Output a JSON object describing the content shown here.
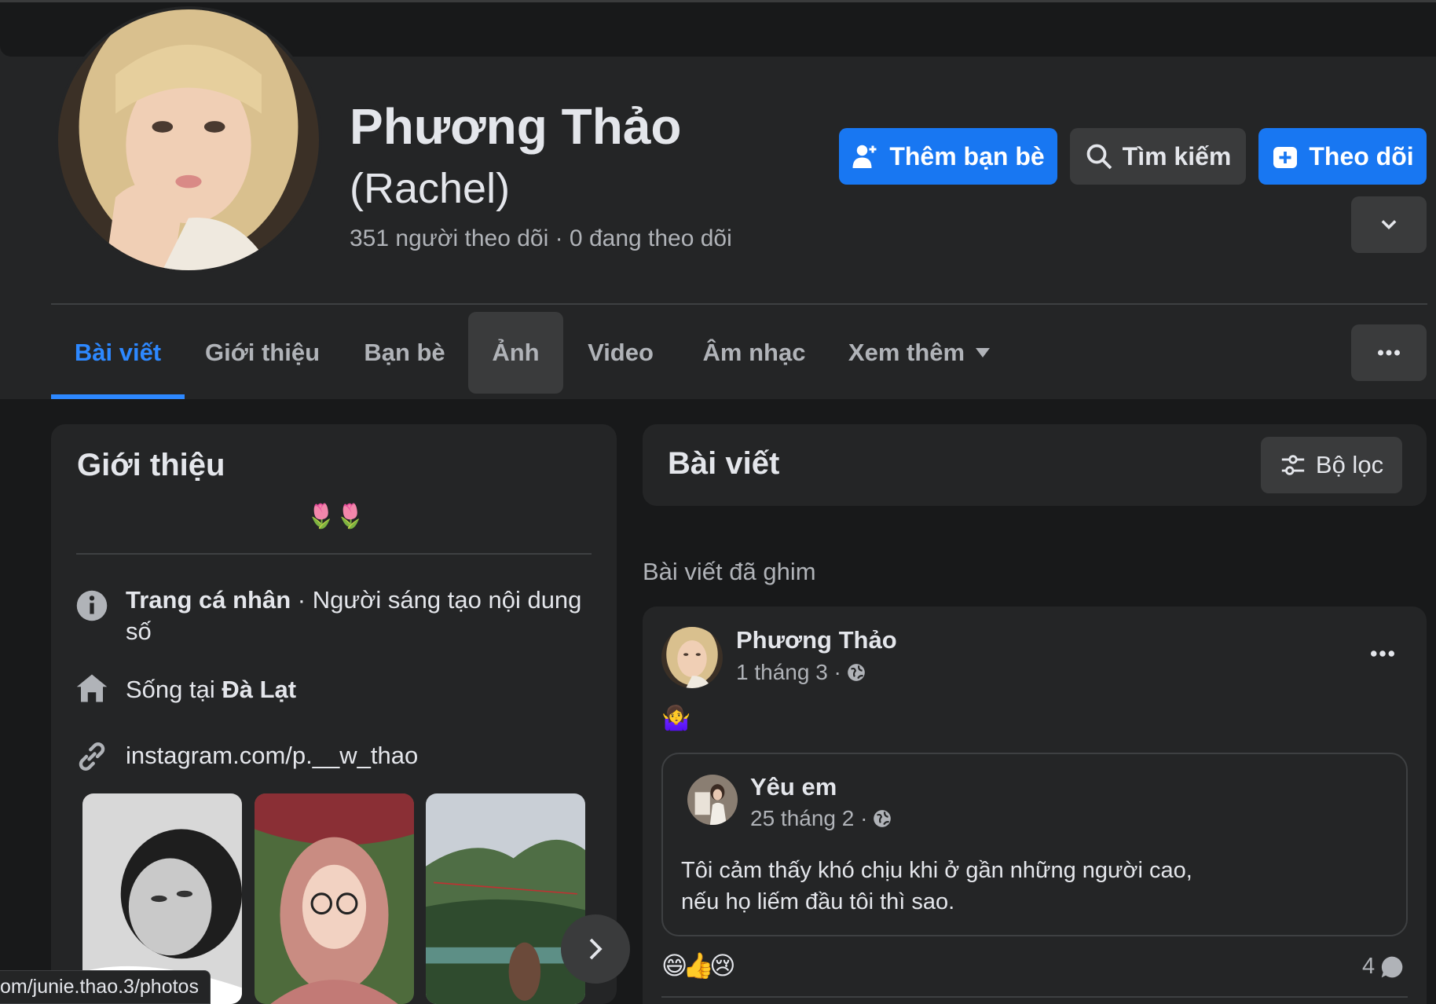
{
  "profile": {
    "name": "Phương Thảo",
    "alt_name": "(Rachel)",
    "stats": "351 người theo dõi · 0 đang theo dõi"
  },
  "actions": {
    "add_friend": "Thêm bạn bè",
    "search": "Tìm kiếm",
    "follow": "Theo dõi"
  },
  "tabs": [
    "Bài viết",
    "Giới thiệu",
    "Bạn bè",
    "Ảnh",
    "Video",
    "Âm nhạc",
    "Xem thêm"
  ],
  "intro": {
    "title": "Giới thiệu",
    "bio": "🌷🌷",
    "page_label": "Trang cá nhân",
    "page_category": " · Người sáng tạo nội dung",
    "page_category_cont": "số",
    "lives_prefix": "Sống tại ",
    "lives_city": "Đà Lạt",
    "link": "instagram.com/p.__w_thao"
  },
  "posts": {
    "title": "Bài viết",
    "filter": "Bộ lọc",
    "pinned_label": "Bài viết đã ghim"
  },
  "post": {
    "author": "Phương Thảo",
    "date": "1 tháng 3 · ",
    "emoji": "🤷‍♀️",
    "shared_author": "Yêu em",
    "shared_date": "25 tháng 2 · ",
    "shared_text_line1": "Tôi cảm thấy khó chịu khi ở gần những người cao,",
    "shared_text_line2": "nếu họ liếm đầu tôi thì sao.",
    "reactions": "😄👍😢",
    "comment_count": "4"
  },
  "status_url": "om/junie.thao.3/photos"
}
